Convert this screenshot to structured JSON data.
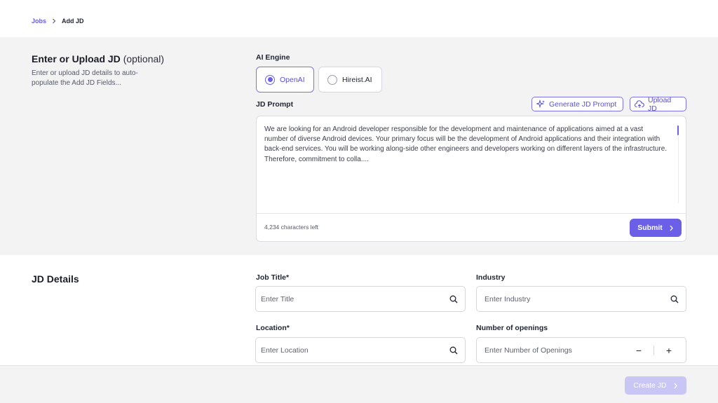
{
  "breadcrumb": {
    "parent": "Jobs",
    "current": "Add JD"
  },
  "upload": {
    "title_main": "Enter or  Upload JD",
    "title_optional": "(optional)",
    "description": "Enter or upload JD details to auto-populate the Add JD Fields...",
    "ai_engine_label": "AI Engine",
    "engines": [
      {
        "label": "OpenAI",
        "selected": true
      },
      {
        "label": "Hireist.AI",
        "selected": false
      }
    ],
    "jd_prompt_label": "JD Prompt",
    "generate_label": "Generate JD Prompt",
    "upload_label": "Upload JD",
    "prompt_text": "We are looking for an Android developer responsible for the development and maintenance of applications aimed at a vast number of diverse Android devices. Your primary focus will be the development of Android applications and their integration with back-end services. You will be working along-side other engineers and developers working on different layers of the infrastructure. Therefore, commitment to colla....",
    "chars_left": "4,234 characters left",
    "submit_label": "Submit"
  },
  "details": {
    "title": "JD Details",
    "job_title_label": "Job Title*",
    "job_title_placeholder": "Enter Title",
    "industry_label": "Industry",
    "industry_placeholder": "Enter Industry",
    "location_label": "Location*",
    "location_placeholder": "Enter Location",
    "openings_label": "Number of openings",
    "openings_placeholder": "Enter Number of Openings",
    "minus": "−",
    "plus": "+"
  },
  "footer": {
    "create_label": "Create JD"
  },
  "colors": {
    "accent": "#6a5fe6",
    "disabled_accent": "#c9c5f4",
    "section_bg": "#f3f3f4"
  }
}
